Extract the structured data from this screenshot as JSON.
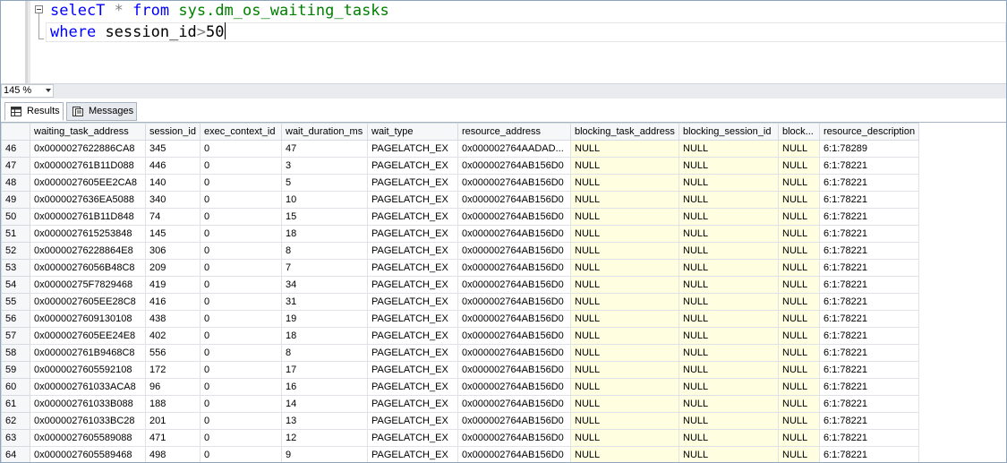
{
  "editor": {
    "line1": {
      "kw1": "selecT",
      "op": "*",
      "kw2": "from",
      "obj": "sys.dm_os_waiting_tasks"
    },
    "line2": {
      "kw": "where",
      "text": "session_id",
      "op": ">",
      "value": "50"
    }
  },
  "zoom": {
    "value": "145 %"
  },
  "tabs": {
    "results": "Results",
    "messages": "Messages"
  },
  "colors": {
    "null_highlight": "#fffee0",
    "keyword": "#0000ff",
    "system_object": "#008000",
    "operator": "#808080"
  },
  "grid": {
    "columns": [
      "waiting_task_address",
      "session_id",
      "exec_context_id",
      "wait_duration_ms",
      "wait_type",
      "resource_address",
      "blocking_task_address",
      "blocking_session_id",
      "block...",
      "resource_description"
    ],
    "rows": [
      {
        "n": "46",
        "c": [
          "0x0000027622886CA8",
          "345",
          "0",
          "47",
          "PAGELATCH_EX",
          "0x000002764AADAD...",
          "NULL",
          "NULL",
          "NULL",
          "6:1:78289"
        ]
      },
      {
        "n": "47",
        "c": [
          "0x000002761B11D088",
          "446",
          "0",
          "3",
          "PAGELATCH_EX",
          "0x000002764AB156D0",
          "NULL",
          "NULL",
          "NULL",
          "6:1:78221"
        ]
      },
      {
        "n": "48",
        "c": [
          "0x0000027605EE2CA8",
          "140",
          "0",
          "5",
          "PAGELATCH_EX",
          "0x000002764AB156D0",
          "NULL",
          "NULL",
          "NULL",
          "6:1:78221"
        ]
      },
      {
        "n": "49",
        "c": [
          "0x0000027636EA5088",
          "340",
          "0",
          "10",
          "PAGELATCH_EX",
          "0x000002764AB156D0",
          "NULL",
          "NULL",
          "NULL",
          "6:1:78221"
        ]
      },
      {
        "n": "50",
        "c": [
          "0x000002761B11D848",
          "74",
          "0",
          "15",
          "PAGELATCH_EX",
          "0x000002764AB156D0",
          "NULL",
          "NULL",
          "NULL",
          "6:1:78221"
        ]
      },
      {
        "n": "51",
        "c": [
          "0x0000027615253848",
          "145",
          "0",
          "18",
          "PAGELATCH_EX",
          "0x000002764AB156D0",
          "NULL",
          "NULL",
          "NULL",
          "6:1:78221"
        ]
      },
      {
        "n": "52",
        "c": [
          "0x00000276228864E8",
          "306",
          "0",
          "8",
          "PAGELATCH_EX",
          "0x000002764AB156D0",
          "NULL",
          "NULL",
          "NULL",
          "6:1:78221"
        ]
      },
      {
        "n": "53",
        "c": [
          "0x00000276056B48C8",
          "209",
          "0",
          "7",
          "PAGELATCH_EX",
          "0x000002764AB156D0",
          "NULL",
          "NULL",
          "NULL",
          "6:1:78221"
        ]
      },
      {
        "n": "54",
        "c": [
          "0x00000275F7829468",
          "419",
          "0",
          "34",
          "PAGELATCH_EX",
          "0x000002764AB156D0",
          "NULL",
          "NULL",
          "NULL",
          "6:1:78221"
        ]
      },
      {
        "n": "55",
        "c": [
          "0x0000027605EE28C8",
          "416",
          "0",
          "31",
          "PAGELATCH_EX",
          "0x000002764AB156D0",
          "NULL",
          "NULL",
          "NULL",
          "6:1:78221"
        ]
      },
      {
        "n": "56",
        "c": [
          "0x0000027609130108",
          "438",
          "0",
          "19",
          "PAGELATCH_EX",
          "0x000002764AB156D0",
          "NULL",
          "NULL",
          "NULL",
          "6:1:78221"
        ]
      },
      {
        "n": "57",
        "c": [
          "0x0000027605EE24E8",
          "402",
          "0",
          "18",
          "PAGELATCH_EX",
          "0x000002764AB156D0",
          "NULL",
          "NULL",
          "NULL",
          "6:1:78221"
        ]
      },
      {
        "n": "58",
        "c": [
          "0x000002761B9468C8",
          "556",
          "0",
          "8",
          "PAGELATCH_EX",
          "0x000002764AB156D0",
          "NULL",
          "NULL",
          "NULL",
          "6:1:78221"
        ]
      },
      {
        "n": "59",
        "c": [
          "0x0000027605592108",
          "172",
          "0",
          "17",
          "PAGELATCH_EX",
          "0x000002764AB156D0",
          "NULL",
          "NULL",
          "NULL",
          "6:1:78221"
        ]
      },
      {
        "n": "60",
        "c": [
          "0x000002761033ACA8",
          "96",
          "0",
          "16",
          "PAGELATCH_EX",
          "0x000002764AB156D0",
          "NULL",
          "NULL",
          "NULL",
          "6:1:78221"
        ]
      },
      {
        "n": "61",
        "c": [
          "0x000002761033B088",
          "188",
          "0",
          "14",
          "PAGELATCH_EX",
          "0x000002764AB156D0",
          "NULL",
          "NULL",
          "NULL",
          "6:1:78221"
        ]
      },
      {
        "n": "62",
        "c": [
          "0x000002761033BC28",
          "201",
          "0",
          "13",
          "PAGELATCH_EX",
          "0x000002764AB156D0",
          "NULL",
          "NULL",
          "NULL",
          "6:1:78221"
        ]
      },
      {
        "n": "63",
        "c": [
          "0x0000027605589088",
          "471",
          "0",
          "12",
          "PAGELATCH_EX",
          "0x000002764AB156D0",
          "NULL",
          "NULL",
          "NULL",
          "6:1:78221"
        ]
      },
      {
        "n": "64",
        "c": [
          "0x0000027605589468",
          "498",
          "0",
          "9",
          "PAGELATCH_EX",
          "0x000002764AB156D0",
          "NULL",
          "NULL",
          "NULL",
          "6:1:78221"
        ]
      }
    ]
  }
}
